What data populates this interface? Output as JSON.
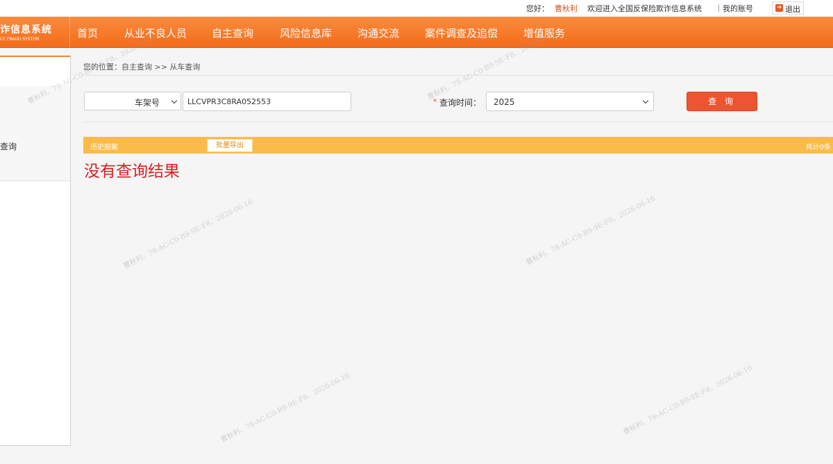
{
  "header": {
    "greeting": "您好：",
    "username": "曹秋利",
    "welcome": "欢迎进入全国反保险欺诈信息系统",
    "account_link": "｜我的账号",
    "logout": "退出"
  },
  "logo": {
    "title_cn": "诈信息系统",
    "title_en": "CE FRAUD SYSTEM"
  },
  "nav": {
    "items": [
      "首页",
      "从业不良人员",
      "自主查询",
      "风险信息库",
      "沟通交流",
      "案件调查及追偿",
      "增值服务"
    ]
  },
  "sidebar": {
    "items": [
      "",
      "",
      "查询",
      ""
    ]
  },
  "breadcrumb": "您的位置：自主查询 >> 从车查询",
  "form": {
    "id_type": "车架号",
    "vin_value": "LLCVPR3C8RA052553",
    "required_mark": "*",
    "time_label": "查询时间：",
    "year": "2025",
    "query_button": "查 询"
  },
  "results": {
    "header": "历史赔案",
    "export_button": "批量导出",
    "count": "共计0条",
    "empty_message": "没有查询结果"
  },
  "watermark": "曹秋利、78-AC-C0-B9-9E-F8、2026-06-16",
  "colors": {
    "nav": "#f36c1b",
    "results_bar": "#fbbb4b",
    "query_button": "#ee5430",
    "empty_text": "#d32222"
  }
}
